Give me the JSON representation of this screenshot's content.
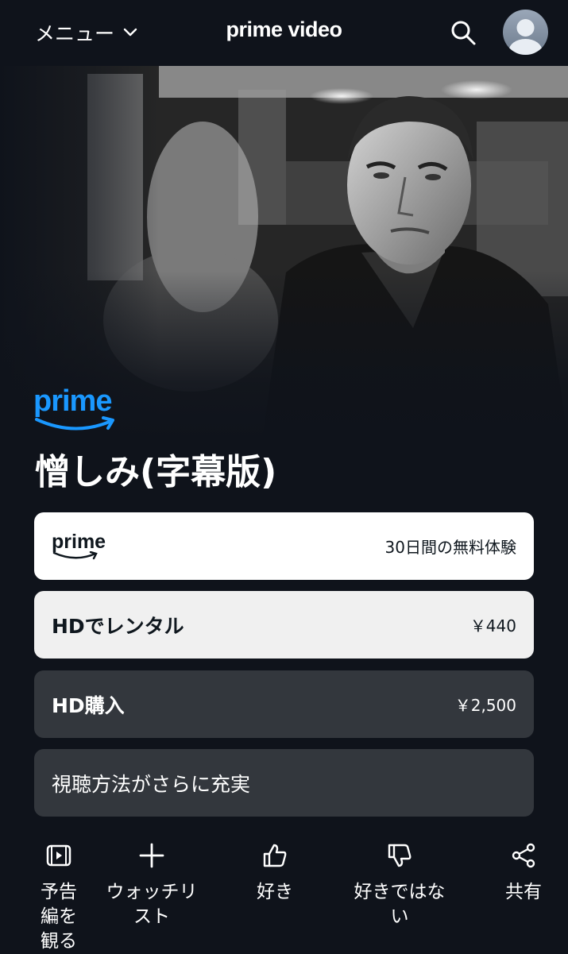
{
  "header": {
    "menu_label": "メニュー",
    "brand": "prime video"
  },
  "hero": {
    "badge": "prime",
    "title": "憎しみ(字幕版)"
  },
  "options": {
    "prime_trial": {
      "logo": "prime",
      "text": "30日間の無料体験"
    },
    "rent": {
      "label": "HDでレンタル",
      "price": "￥440"
    },
    "buy": {
      "label": "HD購入",
      "price": "￥2,500"
    },
    "more": {
      "label": "視聴方法がさらに充実"
    }
  },
  "actions": {
    "trailer": "予告編を観る",
    "watchlist": "ウォッチリスト",
    "like": "好き",
    "dislike": "好きではない",
    "share": "共有"
  },
  "colors": {
    "background": "#0f131b",
    "prime_blue": "#1a98ff",
    "card_dark": "#33373d"
  },
  "icons": [
    "chevron-down-icon",
    "search-icon",
    "avatar-icon",
    "trailer-icon",
    "plus-icon",
    "thumbs-up-icon",
    "thumbs-down-icon",
    "share-icon"
  ]
}
